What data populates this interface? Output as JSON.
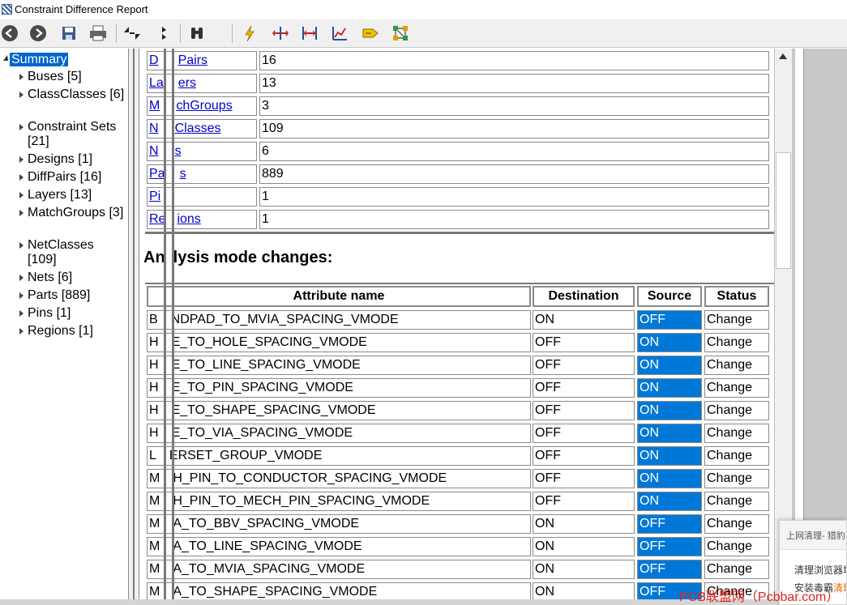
{
  "window": {
    "title": "Constraint Difference Report"
  },
  "toolbar": {
    "buttons": [
      {
        "icon": "back-arrow-icon"
      },
      {
        "icon": "forward-arrow-icon"
      },
      {
        "icon": "save-icon"
      },
      {
        "icon": "print-icon"
      },
      {
        "icon": "expand-collapse-icon"
      },
      {
        "icon": "step-icon"
      },
      {
        "icon": "binoculars-icon"
      },
      {
        "icon": "lightning-icon"
      },
      {
        "icon": "spacing-icon"
      },
      {
        "icon": "measure-icon"
      },
      {
        "icon": "chart-icon"
      },
      {
        "icon": "tag-icon"
      },
      {
        "icon": "network-icon"
      }
    ]
  },
  "tree": {
    "root": "Summary",
    "items": [
      "Buses [5]",
      "ClassClasses [6]",
      "Constraint Sets [21]",
      "Designs [1]",
      "DiffPairs [16]",
      "Layers [13]",
      "MatchGroups [3]",
      "NetClasses [109]",
      "Nets [6]",
      "Parts [889]",
      "Pins [1]",
      "Regions [1]"
    ]
  },
  "summary_table": {
    "rows": [
      {
        "left": "D",
        "right": "Pairs",
        "value": "16"
      },
      {
        "left": "La",
        "right": "ers",
        "value": "13"
      },
      {
        "left": "M",
        "right": "chGroups",
        "value": "3"
      },
      {
        "left": "N",
        "right": "Classes",
        "value": "109"
      },
      {
        "left": "N",
        "right": "s",
        "value": "6"
      },
      {
        "left": "Pa",
        "right": "s",
        "value": "889"
      },
      {
        "left": "Pi",
        "right": "",
        "value": "1"
      },
      {
        "left": "Re",
        "right": "ions",
        "value": "1"
      }
    ]
  },
  "analysis": {
    "heading_left": "An",
    "heading_right": "lysis mode changes:",
    "headers": {
      "attribute": "Attribute name",
      "destination": "Destination",
      "source": "Source",
      "status": "Status"
    },
    "rows": [
      {
        "first": "B",
        "rest": "NDPAD_TO_MVIA_SPACING_VMODE",
        "dest": "ON",
        "src": "OFF",
        "status": "Change"
      },
      {
        "first": "H",
        "rest": "E_TO_HOLE_SPACING_VMODE",
        "dest": "OFF",
        "src": "ON",
        "status": "Change"
      },
      {
        "first": "H",
        "rest": "E_TO_LINE_SPACING_VMODE",
        "dest": "OFF",
        "src": "ON",
        "status": "Change"
      },
      {
        "first": "H",
        "rest": "E_TO_PIN_SPACING_VMODE",
        "dest": "OFF",
        "src": "ON",
        "status": "Change"
      },
      {
        "first": "H",
        "rest": "E_TO_SHAPE_SPACING_VMODE",
        "dest": "OFF",
        "src": "ON",
        "status": "Change"
      },
      {
        "first": "H",
        "rest": "E_TO_VIA_SPACING_VMODE",
        "dest": "OFF",
        "src": "ON",
        "status": "Change"
      },
      {
        "first": "L",
        "rest": "ERSET_GROUP_VMODE",
        "dest": "OFF",
        "src": "ON",
        "status": "Change"
      },
      {
        "first": "M",
        "rest": "H_PIN_TO_CONDUCTOR_SPACING_VMODE",
        "dest": "OFF",
        "src": "ON",
        "status": "Change"
      },
      {
        "first": "M",
        "rest": "H_PIN_TO_MECH_PIN_SPACING_VMODE",
        "dest": "OFF",
        "src": "ON",
        "status": "Change"
      },
      {
        "first": "M",
        "rest": "A_TO_BBV_SPACING_VMODE",
        "dest": "ON",
        "src": "OFF",
        "status": "Change"
      },
      {
        "first": "M",
        "rest": "A_TO_LINE_SPACING_VMODE",
        "dest": "ON",
        "src": "OFF",
        "status": "Change"
      },
      {
        "first": "M",
        "rest": "A_TO_MVIA_SPACING_VMODE",
        "dest": "ON",
        "src": "OFF",
        "status": "Change"
      },
      {
        "first": "M",
        "rest": "A_TO_SHAPE_SPACING_VMODE",
        "dest": "ON",
        "src": "OFF",
        "status": "Change"
      }
    ]
  },
  "popup": {
    "title": "上网清理- 猎豹",
    "line1": "清理浏览器垃",
    "line2_prefix": "安装毒霸",
    "line2_highlight": "清理"
  },
  "watermark": "PCB联盟网（Pcbbar.com）",
  "colors": {
    "selection": "#0066cc",
    "source_cell": "#0078d7",
    "link": "#0000cc",
    "watermark": "#e0261c"
  }
}
